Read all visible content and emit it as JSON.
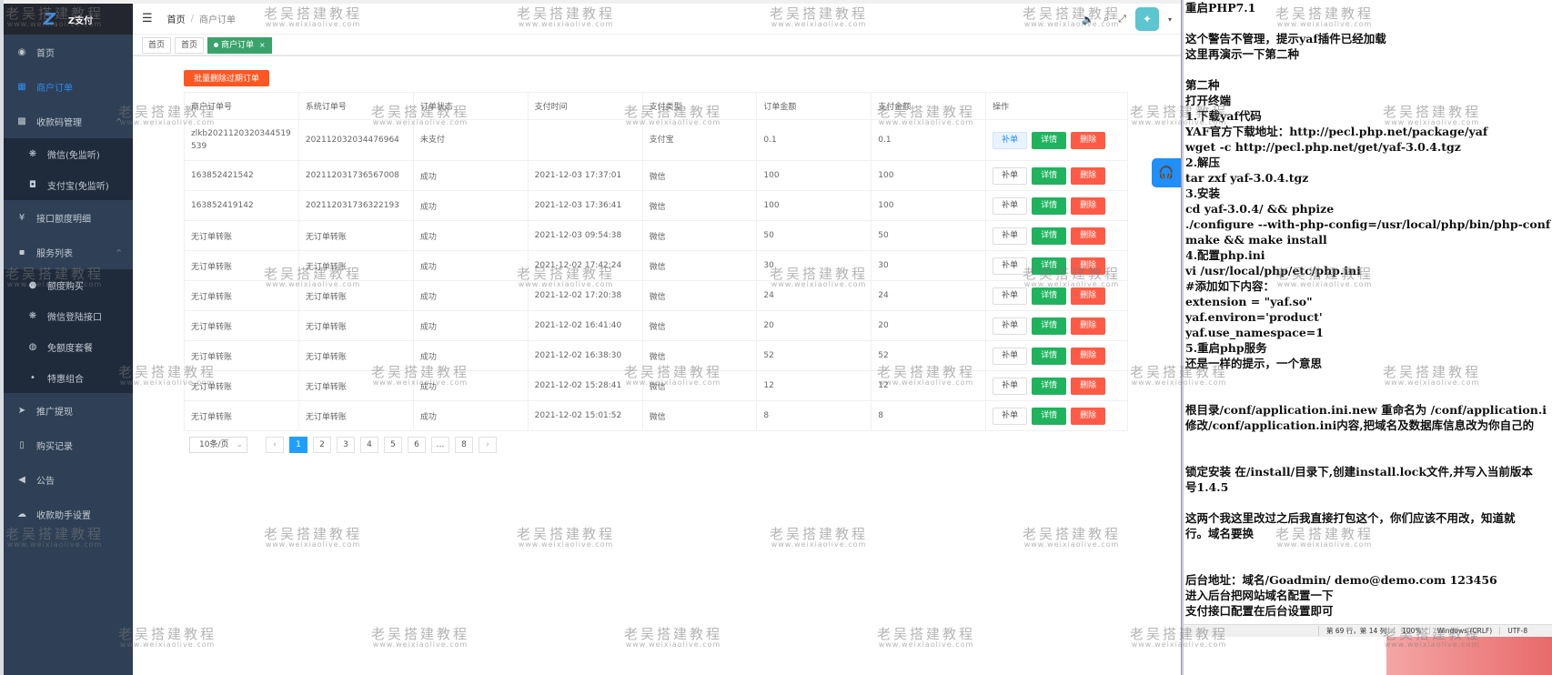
{
  "app": {
    "logo_text": "Z支付"
  },
  "sidebar": {
    "items": [
      {
        "label": "首页",
        "icon": "dashboard-icon",
        "active": false
      },
      {
        "label": "商户订单",
        "icon": "table-icon",
        "active": true
      },
      {
        "label": "收款码管理",
        "icon": "qrcode-icon",
        "active": false,
        "expanded": true,
        "children": [
          {
            "label": "微信(免监听)",
            "icon": "wechat-icon"
          },
          {
            "label": "支付宝(免监听)",
            "icon": "alipay-icon"
          }
        ]
      },
      {
        "label": "接口额度明细",
        "icon": "yen-icon",
        "active": false
      },
      {
        "label": "服务列表",
        "icon": "grid-icon",
        "active": false,
        "expanded": true,
        "children": [
          {
            "label": "额度购买",
            "icon": "coin-icon"
          },
          {
            "label": "微信登陆接口",
            "icon": "wechat-icon"
          },
          {
            "label": "免额度套餐",
            "icon": "package-icon"
          },
          {
            "label": "特惠组合",
            "icon": "discount-icon"
          }
        ]
      },
      {
        "label": "推广提现",
        "icon": "send-icon",
        "active": false
      },
      {
        "label": "购买记录",
        "icon": "phone-icon",
        "active": false
      },
      {
        "label": "公告",
        "icon": "megaphone-icon",
        "active": false
      },
      {
        "label": "收款助手设置",
        "icon": "cloud-icon",
        "active": false
      }
    ]
  },
  "header": {
    "breadcrumb": [
      "首页",
      "商户订单"
    ],
    "breadcrumb_sep": "/"
  },
  "tabs": [
    {
      "label": "首页",
      "active": false
    },
    {
      "label": "首页",
      "active": false
    },
    {
      "label": "商户订单",
      "active": true,
      "close": "×"
    }
  ],
  "toolbar": {
    "batch_delete_label": "批量删除过期订单"
  },
  "table": {
    "columns": [
      "商户订单号",
      "系统订单号",
      "订单状态",
      "支付时间",
      "支付类型",
      "订单金额",
      "支付金额",
      "操作"
    ],
    "action_labels": {
      "supplement": "补单",
      "detail": "详情",
      "delete": "删除"
    },
    "rows": [
      {
        "merchant_order": "zlkb2021120320344519539",
        "system_order": "202112032034476964",
        "status": "未支付",
        "pay_time": "",
        "pay_type": "支付宝",
        "order_amount": "0.1",
        "paid_amount": "0.1"
      },
      {
        "merchant_order": "163852421542",
        "system_order": "202112031736567008",
        "status": "成功",
        "pay_time": "2021-12-03 17:37:01",
        "pay_type": "微信",
        "order_amount": "100",
        "paid_amount": "100"
      },
      {
        "merchant_order": "163852419142",
        "system_order": "202112031736322193",
        "status": "成功",
        "pay_time": "2021-12-03 17:36:41",
        "pay_type": "微信",
        "order_amount": "100",
        "paid_amount": "100"
      },
      {
        "merchant_order": "无订单转账",
        "system_order": "无订单转账",
        "status": "成功",
        "pay_time": "2021-12-03 09:54:38",
        "pay_type": "微信",
        "order_amount": "50",
        "paid_amount": "50"
      },
      {
        "merchant_order": "无订单转账",
        "system_order": "无订单转账",
        "status": "成功",
        "pay_time": "2021-12-02 17:42:24",
        "pay_type": "微信",
        "order_amount": "30",
        "paid_amount": "30"
      },
      {
        "merchant_order": "无订单转账",
        "system_order": "无订单转账",
        "status": "成功",
        "pay_time": "2021-12-02 17:20:38",
        "pay_type": "微信",
        "order_amount": "24",
        "paid_amount": "24"
      },
      {
        "merchant_order": "无订单转账",
        "system_order": "无订单转账",
        "status": "成功",
        "pay_time": "2021-12-02 16:41:40",
        "pay_type": "微信",
        "order_amount": "20",
        "paid_amount": "20"
      },
      {
        "merchant_order": "无订单转账",
        "system_order": "无订单转账",
        "status": "成功",
        "pay_time": "2021-12-02 16:38:30",
        "pay_type": "微信",
        "order_amount": "52",
        "paid_amount": "52"
      },
      {
        "merchant_order": "无订单转账",
        "system_order": "无订单转账",
        "status": "成功",
        "pay_time": "2021-12-02 15:28:41",
        "pay_type": "微信",
        "order_amount": "12",
        "paid_amount": "12"
      },
      {
        "merchant_order": "无订单转账",
        "system_order": "无订单转账",
        "status": "成功",
        "pay_time": "2021-12-02 15:01:52",
        "pay_type": "微信",
        "order_amount": "8",
        "paid_amount": "8"
      }
    ]
  },
  "pagination": {
    "page_size": "10条/页",
    "prev": "‹",
    "next": "›",
    "pages": [
      "1",
      "2",
      "3",
      "4",
      "5",
      "6",
      "…",
      "8"
    ],
    "current": "1"
  },
  "editor": {
    "lines": [
      "重启PHP7.1",
      "",
      "这个警告不管理，提示yaf插件已经加载",
      "这里再演示一下第二种",
      "",
      "第二种",
      "打开终端",
      "1.下载yaf代码",
      "YAF官方下载地址：http://pecl.php.net/package/yaf",
      "wget -c http://pecl.php.net/get/yaf-3.0.4.tgz",
      "2.解压",
      "tar zxf yaf-3.0.4.tgz",
      "3.安装",
      "cd yaf-3.0.4/ && phpize",
      "./configure --with-php-config=/usr/local/php/bin/php-conf",
      "make && make install",
      "4.配置php.ini",
      "vi /usr/local/php/etc/php.ini",
      "#添加如下内容：",
      "extension = \"yaf.so\"",
      "yaf.environ='product'",
      "yaf.use_namespace=1",
      "5.重启php服务",
      "还是一样的提示，一个意思",
      "",
      "",
      "根目录/conf/application.ini.new 重命名为 /conf/application.i",
      "修改/conf/application.ini内容,把域名及数据库信息改为你自己的",
      "",
      "",
      "锁定安装 在/install/目录下,创建install.lock文件,并写入当前版本",
      "号1.4.5",
      "",
      "这两个我这里改过之后我直接打包这个，你们应该不用改，知道就",
      "行。域名要换",
      "",
      "",
      "后台地址：域名/Goadmin/   demo@demo.com   123456",
      "进入后台把网站域名配置一下",
      "支付接口配置在后台设置即可"
    ],
    "status": {
      "position": "第 69 行，第 14 列",
      "zoom": "100%",
      "line_ending": "Windows (CRLF)",
      "encoding": "UTF-8"
    }
  },
  "watermark": {
    "title": "老吴搭建教程",
    "url": "www.weixiaolive.com"
  }
}
